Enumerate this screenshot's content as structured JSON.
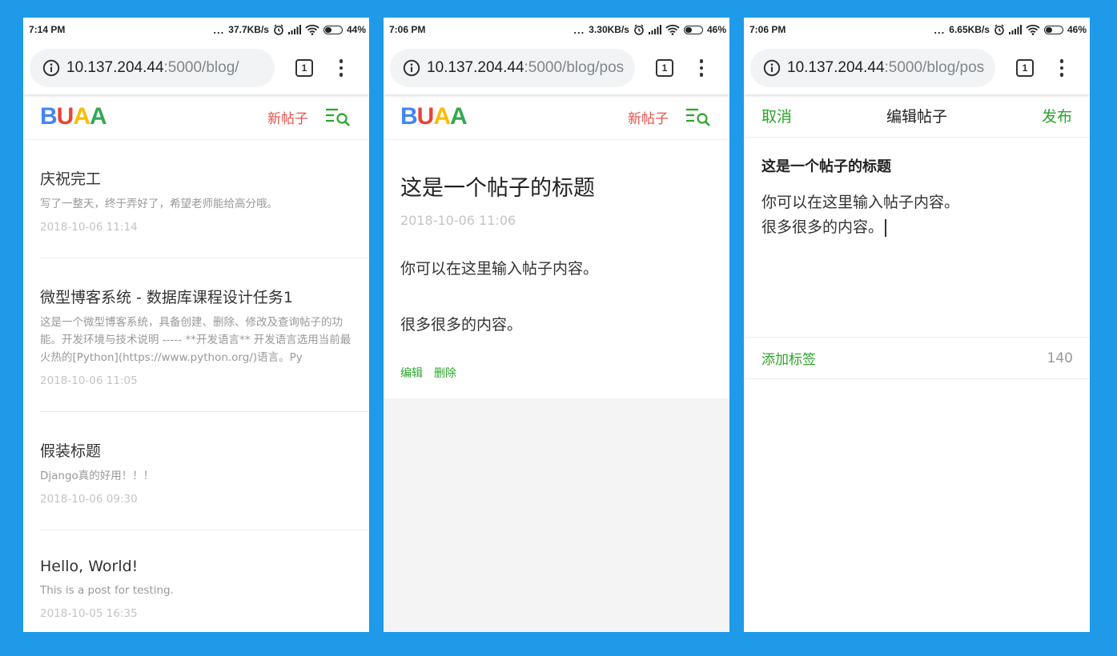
{
  "colors": {
    "background": "#1e9ae9",
    "accent_green": "#2aa52a",
    "new_post_red": "#e9504a",
    "logo": [
      "#4285f4",
      "#ea4335",
      "#fbbc05",
      "#34a853"
    ]
  },
  "logo": {
    "b": "B",
    "u": "U",
    "a1": "A",
    "a2": "A"
  },
  "screens": [
    {
      "status": {
        "time": "7:14 PM",
        "dots": "...",
        "speed": "37.7KB/s",
        "battery": "44%"
      },
      "battery_level": 0.44,
      "url": {
        "host": "10.137.204.44",
        "rest": ":5000/blog/"
      },
      "tab_count": "1",
      "header": {
        "new_post": "新帖子"
      },
      "posts": [
        {
          "title": "庆祝完工",
          "summary": "写了一整天，终于弄好了，希望老师能给高分哦。",
          "date": "2018-10-06 11:14"
        },
        {
          "title": "微型博客系统 - 数据库课程设计任务1",
          "summary": "这是一个微型博客系统，具备创建、删除、修改及查询帖子的功能。开发环境与技术说明 ----- **开发语言** 开发语言选用当前最火热的[Python](https://www.python.org/)语言。Py",
          "date": "2018-10-06 11:05"
        },
        {
          "title": "假装标题",
          "summary": "Django真的好用！！！",
          "date": "2018-10-06 09:30"
        },
        {
          "title": "Hello, World!",
          "summary": "This is a post for testing.",
          "date": "2018-10-05 16:35"
        }
      ]
    },
    {
      "status": {
        "time": "7:06 PM",
        "dots": "...",
        "speed": "3.30KB/s",
        "battery": "46%"
      },
      "battery_level": 0.46,
      "url": {
        "host": "10.137.204.44",
        "rest": ":5000/blog/pos"
      },
      "tab_count": "1",
      "header": {
        "new_post": "新帖子"
      },
      "detail": {
        "title": "这是一个帖子的标题",
        "date": "2018-10-06 11:06",
        "paragraphs": [
          "你可以在这里输入帖子内容。",
          "很多很多的内容。"
        ],
        "edit": "编辑",
        "delete": "删除"
      }
    },
    {
      "status": {
        "time": "7:06 PM",
        "dots": "...",
        "speed": "6.65KB/s",
        "battery": "46%"
      },
      "battery_level": 0.46,
      "url": {
        "host": "10.137.204.44",
        "rest": ":5000/blog/pos"
      },
      "tab_count": "1",
      "editor": {
        "cancel": "取消",
        "title": "编辑帖子",
        "publish": "发布",
        "post_title": "这是一个帖子的标题",
        "content_lines": [
          "你可以在这里输入帖子内容。",
          "很多很多的内容。"
        ],
        "add_tag": "添加标签",
        "char_count": "140"
      }
    }
  ]
}
